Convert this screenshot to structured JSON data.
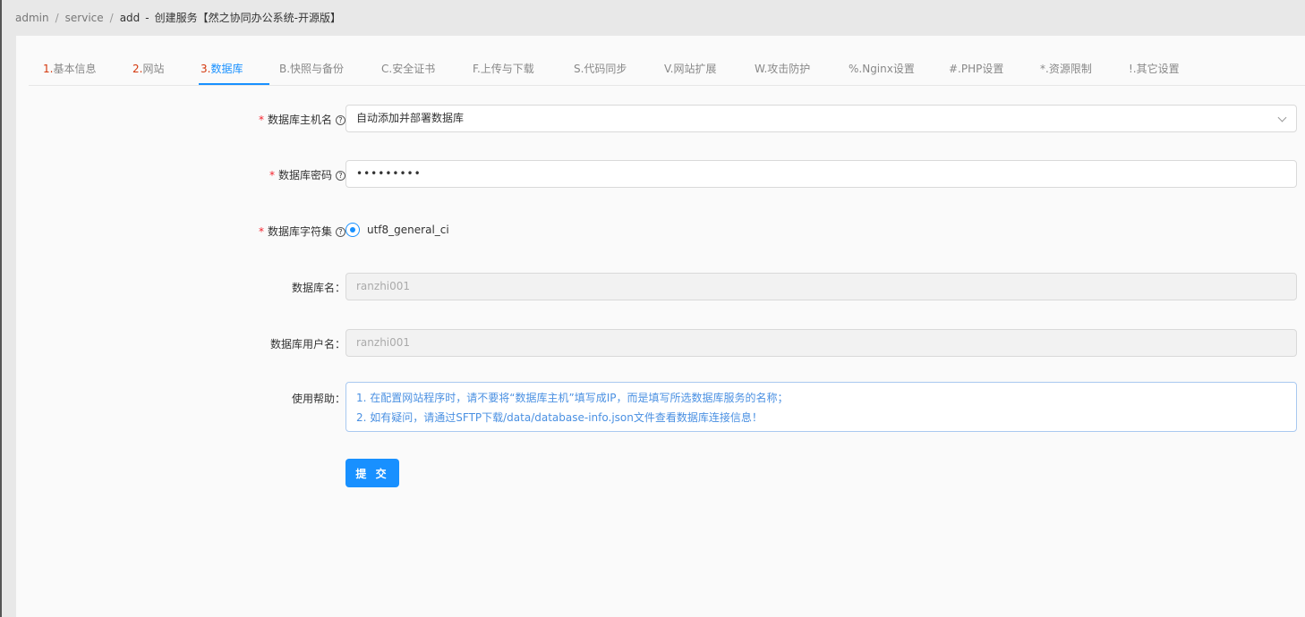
{
  "breadcrumb": {
    "items": [
      "admin",
      "service",
      "add"
    ],
    "separator": "/",
    "title": "创建服务【然之协同办公系统-开源版】",
    "dash": "-"
  },
  "tabs": [
    {
      "num": "1.",
      "label": "基本信息"
    },
    {
      "num": "2.",
      "label": "网站"
    },
    {
      "num": "3.",
      "label": "数据库"
    },
    {
      "num": "",
      "label": "B.快照与备份"
    },
    {
      "num": "",
      "label": "C.安全证书"
    },
    {
      "num": "",
      "label": "F.上传与下载"
    },
    {
      "num": "",
      "label": "S.代码同步"
    },
    {
      "num": "",
      "label": "V.网站扩展"
    },
    {
      "num": "",
      "label": "W.攻击防护"
    },
    {
      "num": "",
      "label": "%.Nginx设置"
    },
    {
      "num": "",
      "label": "#.PHP设置"
    },
    {
      "num": "",
      "label": "*.资源限制"
    },
    {
      "num": "",
      "label": "!.其它设置"
    }
  ],
  "active_tab": 2,
  "form": {
    "host": {
      "label": "数据库主机名",
      "value": "自动添加并部署数据库"
    },
    "password": {
      "label": "数据库密码",
      "value": "•••••••••"
    },
    "charset": {
      "label": "数据库字符集",
      "option": "utf8_general_ci"
    },
    "dbname": {
      "label": "数据库名：",
      "value": "ranzhi001"
    },
    "dbuser": {
      "label": "数据库用户名：",
      "value": "ranzhi001"
    },
    "help": {
      "label": "使用帮助：",
      "lines": [
        "1. 在配置网站程序时，请不要将“数据库主机”填写成IP，而是填写所选数据库服务的名称；",
        "2. 如有疑问，请通过SFTP下载/data/database-info.json文件查看数据库连接信息！"
      ]
    },
    "submit": "提 交",
    "required_mark": "*",
    "help_icon": "?"
  },
  "colors": {
    "accent": "#1890ff",
    "required": "#f5222d",
    "tab_num": "#d4380d"
  }
}
